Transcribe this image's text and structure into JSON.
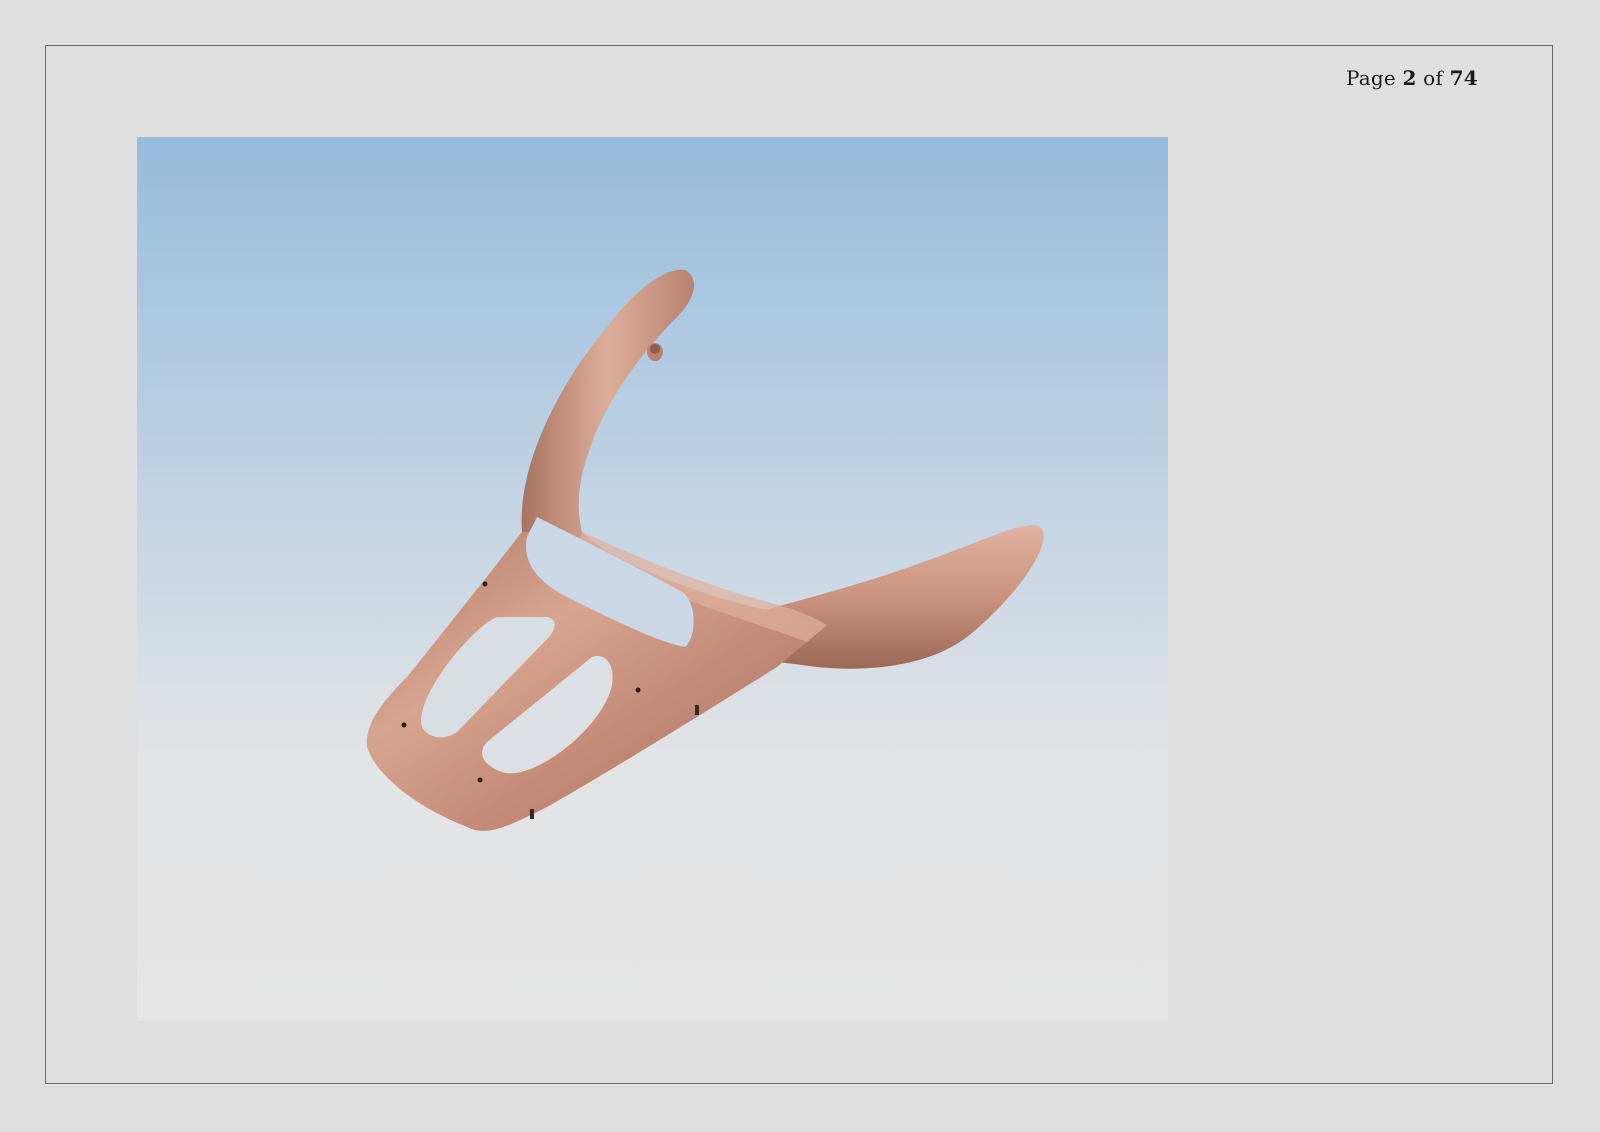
{
  "page_indicator": {
    "prefix": "Page",
    "current": "2",
    "separator": "of",
    "total": "74"
  },
  "figure": {
    "subject": "luggage-rack-3d-render",
    "part_color": "#c9937f",
    "background_top": "#97bcdc",
    "background_bottom": "#e4e4e4"
  }
}
